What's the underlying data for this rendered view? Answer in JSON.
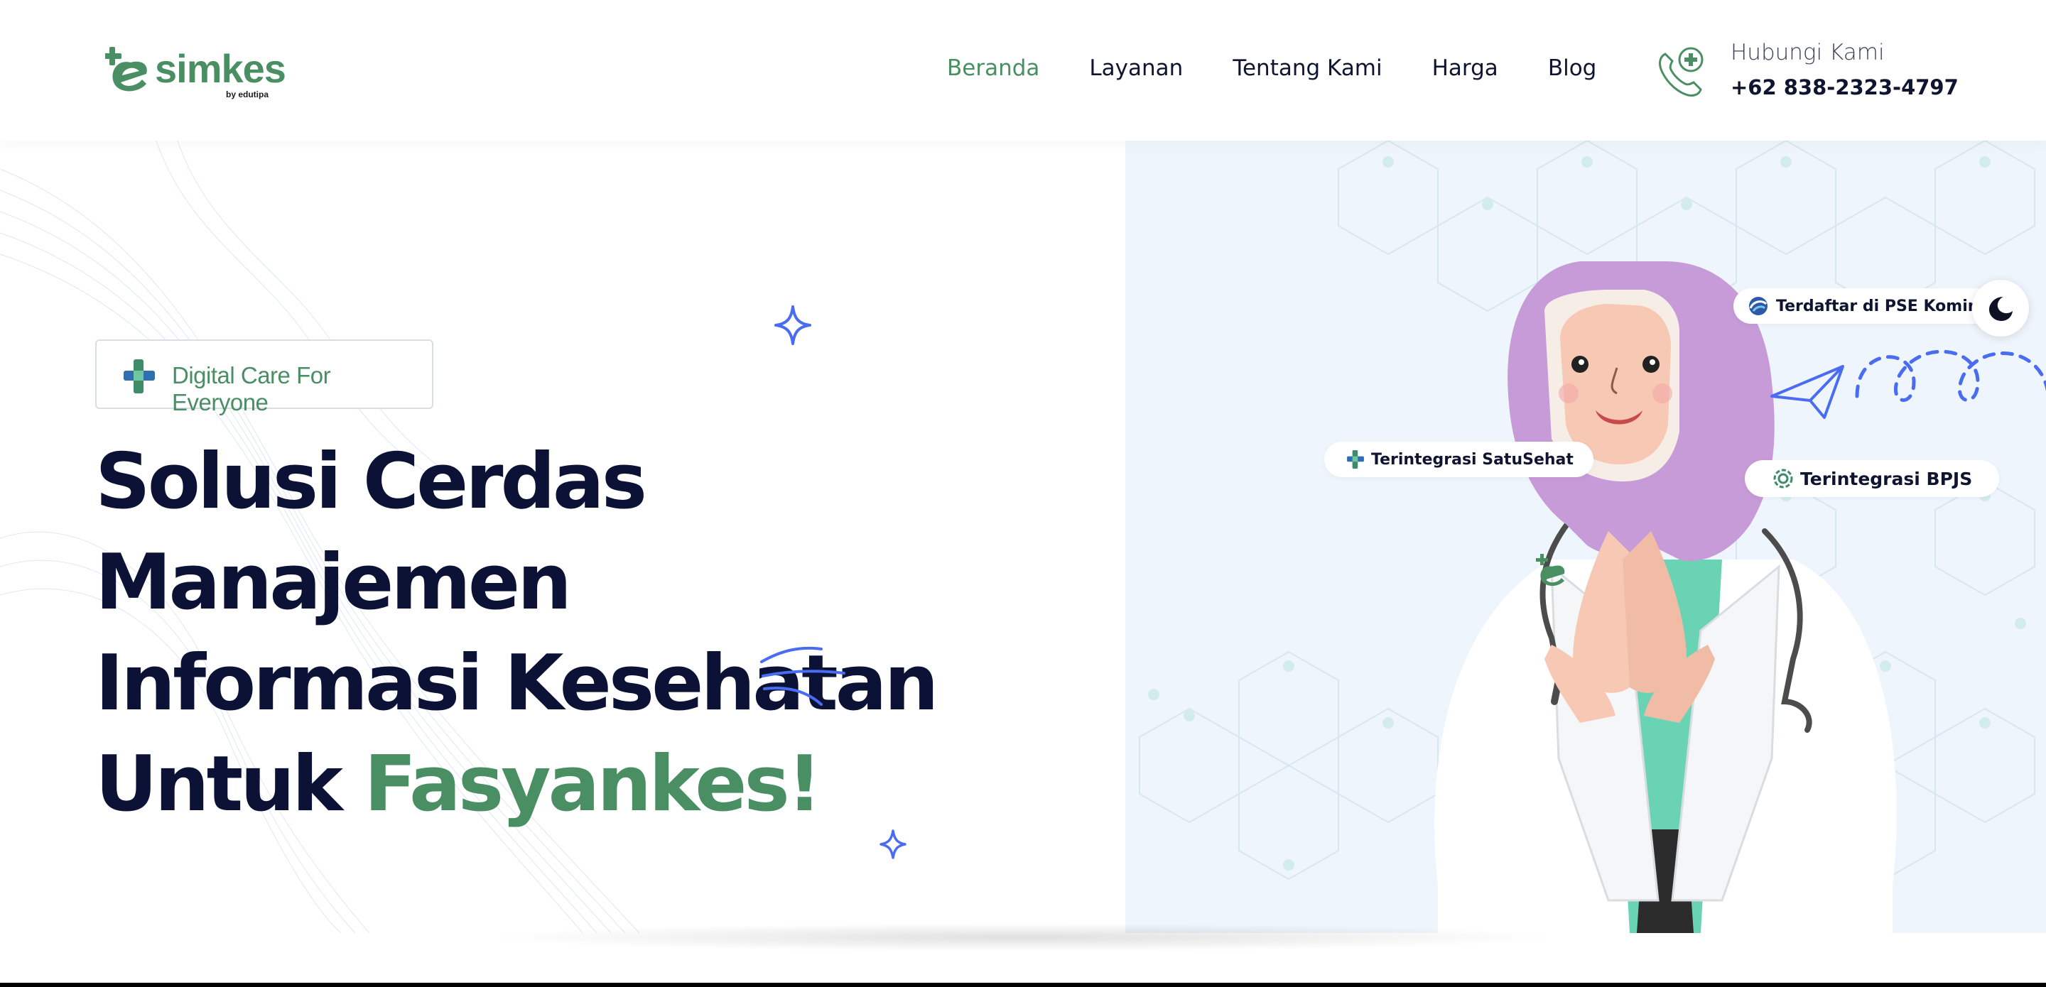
{
  "brand": {
    "name": "simkes",
    "byline": "by edutipa"
  },
  "nav": {
    "items": [
      {
        "label": "Beranda",
        "active": true
      },
      {
        "label": "Layanan",
        "active": false
      },
      {
        "label": "Tentang Kami",
        "active": false
      },
      {
        "label": "Harga",
        "active": false
      },
      {
        "label": "Blog",
        "active": false
      }
    ]
  },
  "contact": {
    "title": "Hubungi Kami",
    "phone": "+62 838-2323-4797",
    "icon": "phone-icon"
  },
  "hero": {
    "badge": "Digital Care For Everyone",
    "headline_line1": "Solusi Cerdas Manajemen",
    "headline_line2": "Informasi Kesehatan",
    "headline_line3_prefix": "Untuk ",
    "headline_line3_highlight": "Fasyankes!"
  },
  "chips": {
    "pse": "Terdaftar di PSE Kominfo",
    "satusehat": "Terintegrasi SatuSehat",
    "bpjs": "Terintegrasi BPJS"
  },
  "colors": {
    "brand_green": "#4a8f63",
    "navy": "#0c1236",
    "accent_blue": "#4a6cf0",
    "hijab": "#c79ad8",
    "scrubs": "#6ad3b4"
  }
}
